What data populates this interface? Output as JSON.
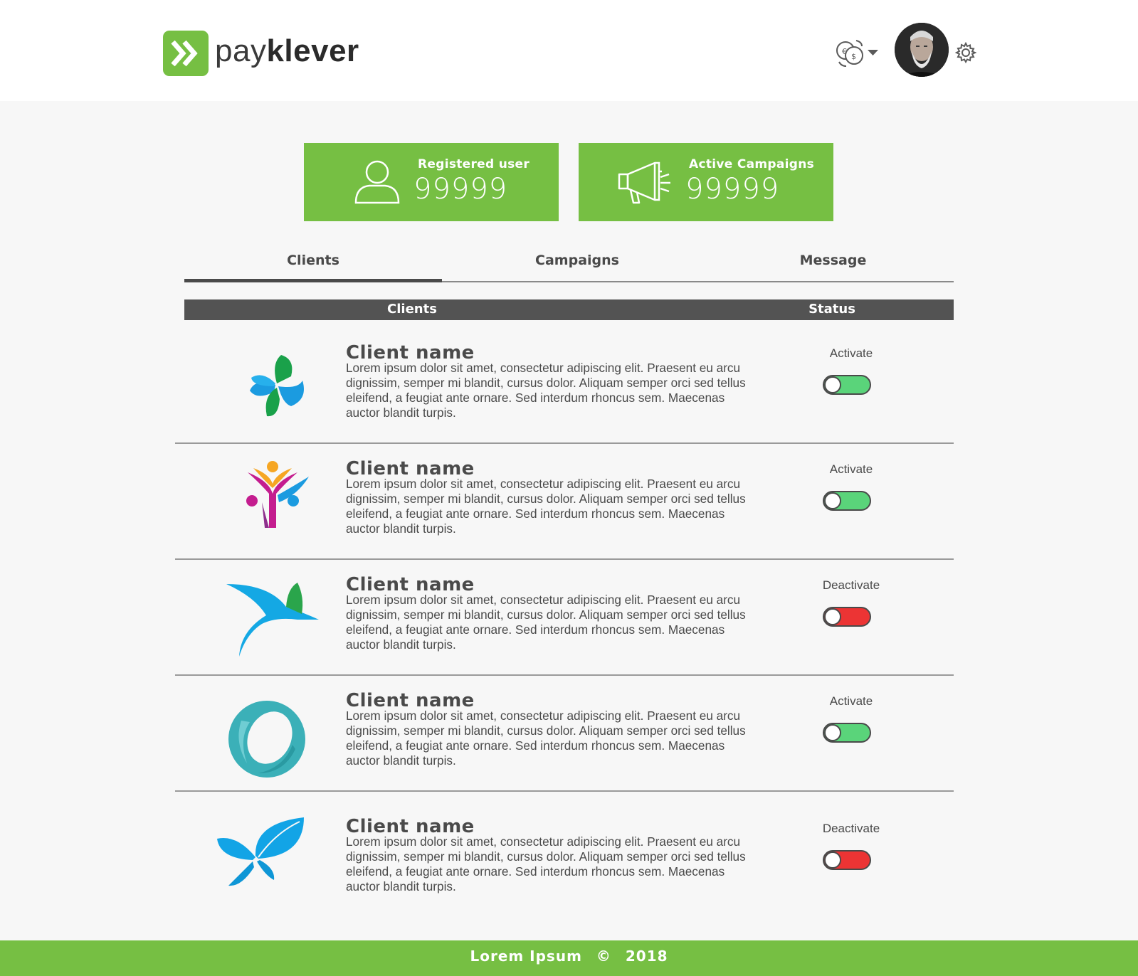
{
  "brand": {
    "name_light": "pay",
    "name_bold": "klever",
    "color": "#76bf43"
  },
  "header": {
    "currency_icon": "currency-exchange-icon",
    "avatar_icon": "user-avatar",
    "settings_icon": "gear-icon"
  },
  "stats": [
    {
      "label": "Registered user",
      "value": "99999",
      "icon": "user-icon"
    },
    {
      "label": "Active Campaigns",
      "value": "99999",
      "icon": "megaphone-icon"
    }
  ],
  "tabs": [
    {
      "label": "Clients",
      "active": true
    },
    {
      "label": "Campaigns",
      "active": false
    },
    {
      "label": "Message",
      "active": false
    }
  ],
  "table": {
    "headers": {
      "clients": "Clients",
      "status": "Status"
    },
    "rows": [
      {
        "name": "Client name",
        "description": "Lorem ipsum dolor sit amet, consectetur adipiscing elit. Praesent eu arcu dignissim, semper mi blandit, cursus dolor. Aliquam semper orci sed tellus eleifend, a feugiat ante ornare. Sed interdum rhoncus sem. Maecenas auctor blandit turpis.",
        "status": "Activate",
        "enabled": true,
        "logo": "clover-logo"
      },
      {
        "name": "Client name",
        "description": "Lorem ipsum dolor sit amet, consectetur adipiscing elit. Praesent eu arcu dignissim, semper mi blandit, cursus dolor. Aliquam semper orci sed tellus eleifend, a feugiat ante ornare. Sed interdum rhoncus sem. Maecenas auctor blandit turpis.",
        "status": "Activate",
        "enabled": true,
        "logo": "people-logo"
      },
      {
        "name": "Client name",
        "description": "Lorem ipsum dolor sit amet, consectetur adipiscing elit. Praesent eu arcu dignissim, semper mi blandit, cursus dolor. Aliquam semper orci sed tellus eleifend, a feugiat ante ornare. Sed interdum rhoncus sem. Maecenas auctor blandit turpis.",
        "status": "Deactivate",
        "enabled": false,
        "logo": "bird-logo"
      },
      {
        "name": "Client name",
        "description": "Lorem ipsum dolor sit amet, consectetur adipiscing elit. Praesent eu arcu dignissim, semper mi blandit, cursus dolor. Aliquam semper orci sed tellus eleifend, a feugiat ante ornare. Sed interdum rhoncus sem. Maecenas auctor blandit turpis.",
        "status": "Activate",
        "enabled": true,
        "logo": "ring-logo"
      },
      {
        "name": "Client name",
        "description": "Lorem ipsum dolor sit amet, consectetur adipiscing elit. Praesent eu arcu dignissim, semper mi blandit, cursus dolor. Aliquam semper orci sed tellus eleifend, a feugiat ante ornare. Sed interdum rhoncus sem. Maecenas auctor blandit turpis.",
        "status": "Deactivate",
        "enabled": false,
        "logo": "butterfly-logo"
      }
    ]
  },
  "footer": {
    "text": "Lorem Ipsum",
    "symbol": "©",
    "year": "2018"
  },
  "colors": {
    "accent": "#76bf43",
    "toggle_on": "#5ad47a",
    "toggle_off": "#ec3434",
    "table_header": "#535353"
  }
}
